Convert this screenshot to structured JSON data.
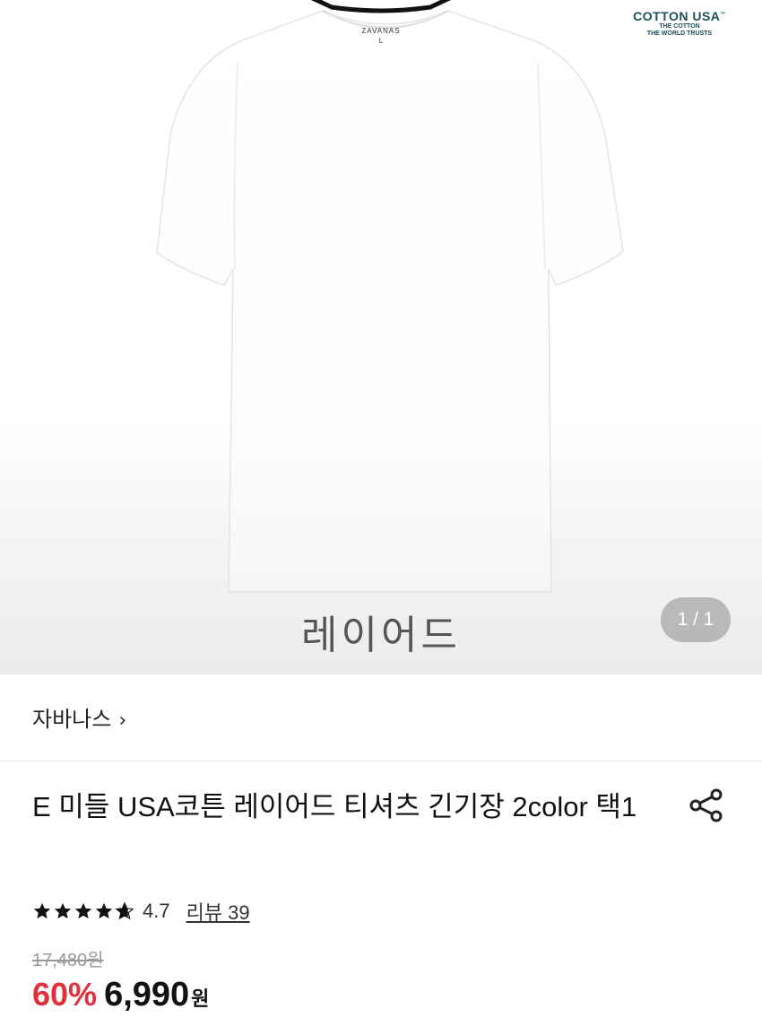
{
  "product_image": {
    "brand_logo": {
      "line1": "COTTON USA",
      "tm": "™",
      "line2": "THE COTTON",
      "line3": "THE WORLD TRUSTS"
    },
    "shirt_tag": {
      "brand": "ZAVANAS",
      "size": "L"
    },
    "watermark": "레이어드",
    "page_counter": "1 / 1"
  },
  "seller": {
    "name": "자바나스",
    "chevron": "›"
  },
  "product": {
    "title": "E 미들 USA코튼 레이어드 티셔츠 긴기장 2color 택1",
    "share_icon": "share-icon"
  },
  "rating": {
    "stars": 4.7,
    "value": "4.7",
    "review_label": "리뷰 39"
  },
  "price": {
    "original": "17,480원",
    "discount": "60%",
    "sale": "6,990",
    "currency": "원"
  },
  "colors": {
    "discount": "#e0313b",
    "text": "#111111"
  }
}
